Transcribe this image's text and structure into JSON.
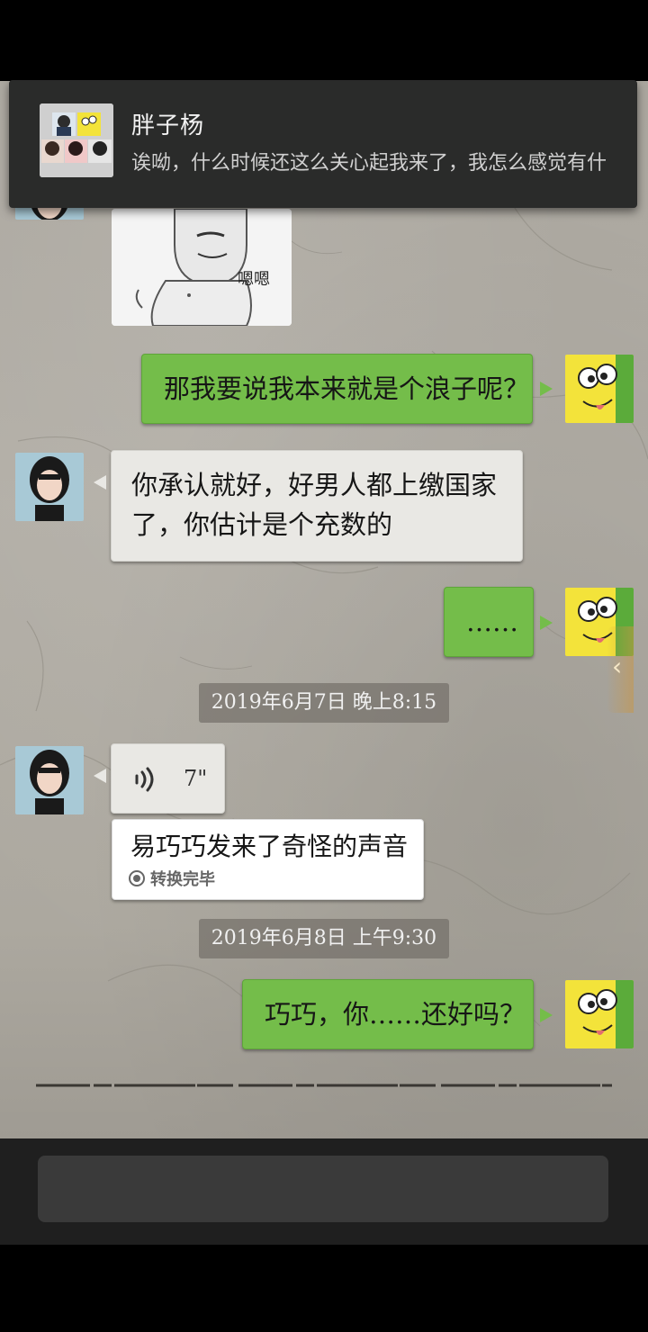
{
  "notification": {
    "title": "胖子杨",
    "text": "诶呦，什么时候还这么关心起我来了，我怎么感觉有什"
  },
  "sticker": {
    "caption": "嗯嗯"
  },
  "messages": [
    {
      "side": "right",
      "text": "那我要说我本来就是个浪子呢？"
    },
    {
      "side": "left",
      "text_line1": "你承认就好，好男人都上缴国家",
      "text_line2": "了，你估计是个充数的"
    },
    {
      "side": "right",
      "text": "……"
    },
    {
      "side": "left",
      "type": "voice",
      "duration": "7\""
    },
    {
      "side": "left",
      "type": "voice_transcript",
      "text": "易巧巧发来了奇怪的声音",
      "status": "转换完毕"
    },
    {
      "side": "right",
      "text": "巧巧，你……还好吗？"
    }
  ],
  "timestamps": {
    "t1": "2019年6月7日 晚上8:15",
    "t2": "2019年6月8日 上午9:30"
  },
  "side_handle": {
    "glyph": "‹"
  },
  "colors": {
    "right_bubble": "#74bd4a",
    "left_bubble": "#e9e8e4",
    "notification_bg": "#2a2b2a",
    "input_bar": "#1f1f1f"
  }
}
